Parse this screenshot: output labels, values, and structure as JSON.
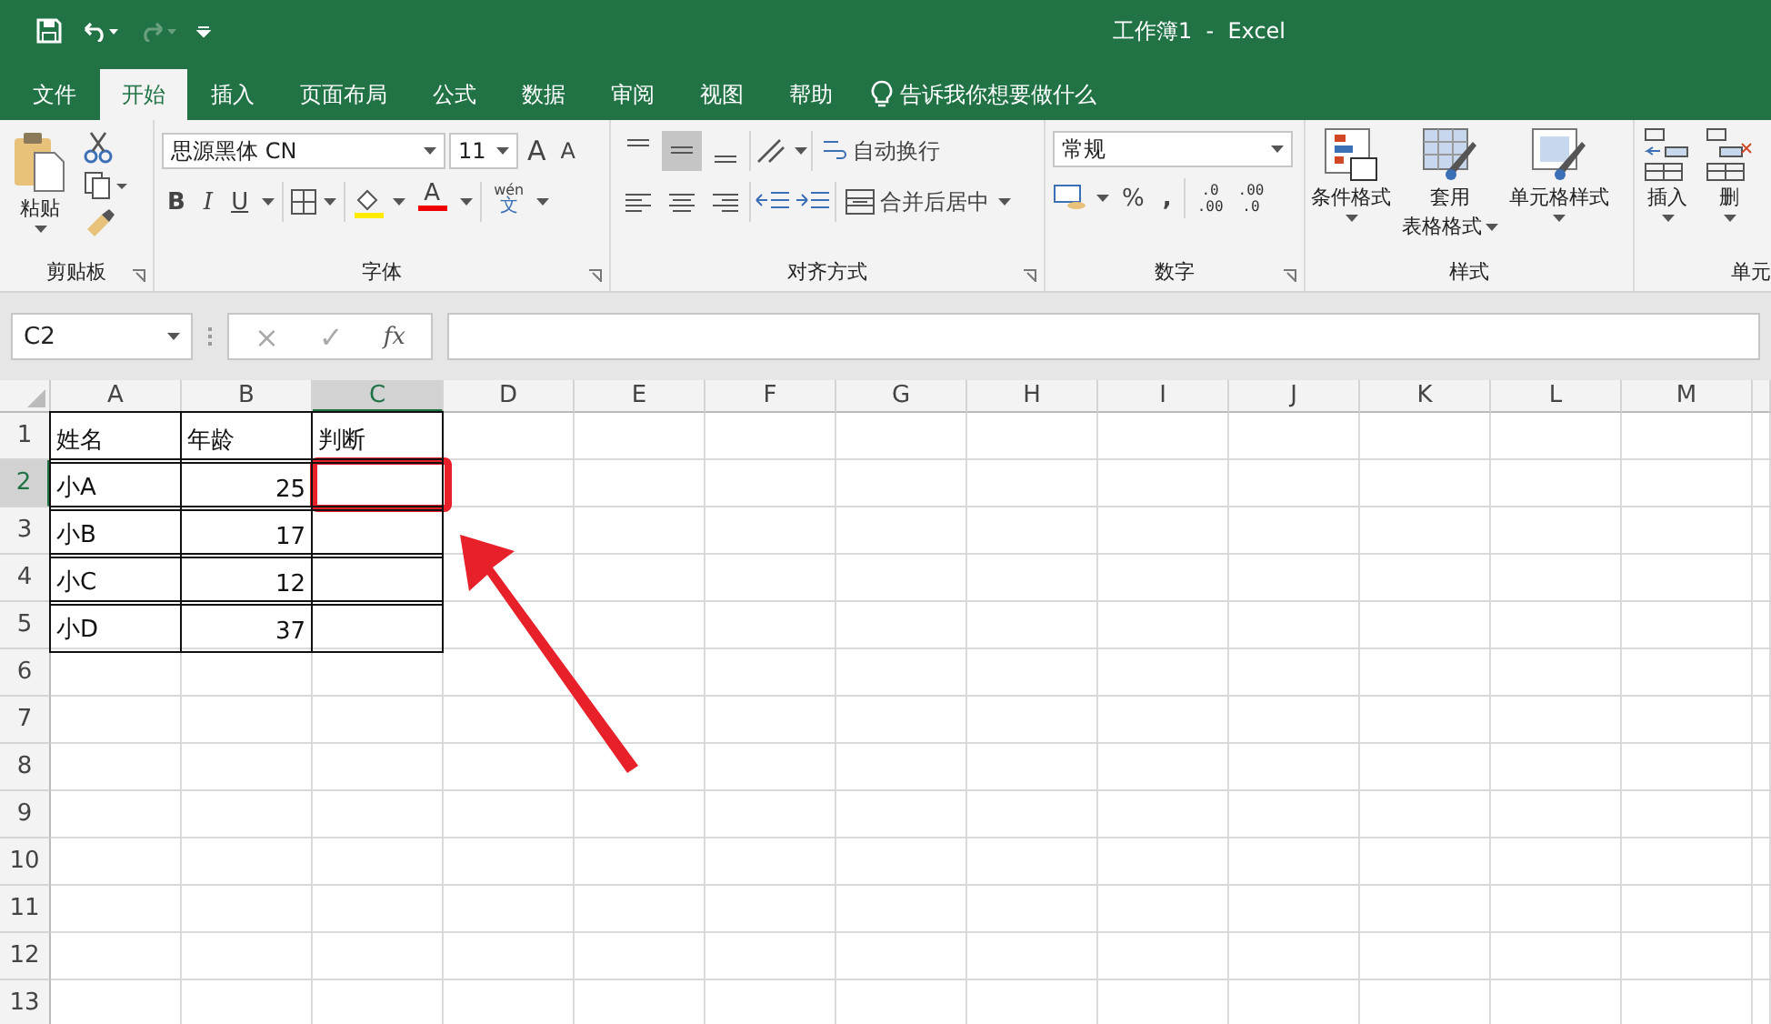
{
  "title_bar": {
    "title": "工作簿1  -  Excel"
  },
  "ribbon_tabs": [
    {
      "label": "文件",
      "selected": false
    },
    {
      "label": "开始",
      "selected": true
    },
    {
      "label": "插入",
      "selected": false
    },
    {
      "label": "页面布局",
      "selected": false
    },
    {
      "label": "公式",
      "selected": false
    },
    {
      "label": "数据",
      "selected": false
    },
    {
      "label": "审阅",
      "selected": false
    },
    {
      "label": "视图",
      "selected": false
    },
    {
      "label": "帮助",
      "selected": false
    }
  ],
  "tell_me": "告诉我你想要做什么",
  "clipboard": {
    "paste": "粘贴",
    "group": "剪贴板"
  },
  "font": {
    "name": "思源黑体 CN",
    "size": "11",
    "grow": "A",
    "shrink": "A",
    "bold": "B",
    "italic": "I",
    "underline": "U",
    "font_color": "A",
    "phonetic_top": "wén",
    "phonetic_bottom": "文",
    "group": "字体"
  },
  "alignment": {
    "wrap": "自动换行",
    "merge": "合并后居中",
    "group": "对齐方式"
  },
  "number": {
    "format": "常规",
    "percent": "%",
    "comma": ",",
    "increase_decimal": [
      ".0",
      ".00"
    ],
    "decrease_decimal": [
      ".00",
      ".0"
    ],
    "group": "数字"
  },
  "styles": {
    "conditional": "条件格式",
    "table_top": "套用",
    "table_bottom": "表格格式",
    "cell_styles": "单元格样式",
    "group": "样式"
  },
  "cells_group": {
    "insert": "插入",
    "delete": "删",
    "group": "单元"
  },
  "formula_bar": {
    "name_box": "C2",
    "cancel": "×",
    "enter": "✓",
    "fx": "fx"
  },
  "sheet": {
    "columns": [
      {
        "label": "A",
        "selected": false
      },
      {
        "label": "B",
        "selected": false
      },
      {
        "label": "C",
        "selected": true
      },
      {
        "label": "D",
        "selected": false
      },
      {
        "label": "E",
        "selected": false
      },
      {
        "label": "F",
        "selected": false
      },
      {
        "label": "G",
        "selected": false
      },
      {
        "label": "H",
        "selected": false
      },
      {
        "label": "I",
        "selected": false
      },
      {
        "label": "J",
        "selected": false
      },
      {
        "label": "K",
        "selected": false
      },
      {
        "label": "L",
        "selected": false
      },
      {
        "label": "M",
        "selected": false
      }
    ],
    "rows": [
      {
        "header": "1",
        "selected": false,
        "bordered": true,
        "cells": [
          {
            "kind": "text",
            "text": "姓名"
          },
          {
            "kind": "text",
            "text": "年龄"
          },
          {
            "kind": "text",
            "text": "判断"
          }
        ]
      },
      {
        "header": "2",
        "selected": true,
        "bordered": true,
        "cells": [
          {
            "kind": "text",
            "text": "小A"
          },
          {
            "kind": "number",
            "text": "25"
          }
        ]
      },
      {
        "header": "3",
        "selected": false,
        "bordered": true,
        "cells": [
          {
            "kind": "text",
            "text": "小B"
          },
          {
            "kind": "number",
            "text": "17"
          }
        ]
      },
      {
        "header": "4",
        "selected": false,
        "bordered": true,
        "cells": [
          {
            "kind": "text",
            "text": "小C"
          },
          {
            "kind": "number",
            "text": "12"
          }
        ]
      },
      {
        "header": "5",
        "selected": false,
        "bordered": true,
        "cells": [
          {
            "kind": "text",
            "text": "小D"
          },
          {
            "kind": "number",
            "text": "37"
          }
        ]
      },
      {
        "header": "6",
        "selected": false,
        "bordered": false
      },
      {
        "header": "7",
        "selected": false,
        "bordered": false
      },
      {
        "header": "8",
        "selected": false,
        "bordered": false
      },
      {
        "header": "9",
        "selected": false,
        "bordered": false
      },
      {
        "header": "10",
        "selected": false,
        "bordered": false
      },
      {
        "header": "11",
        "selected": false,
        "bordered": false
      },
      {
        "header": "12",
        "selected": false,
        "bordered": false
      },
      {
        "header": "13",
        "selected": false,
        "bordered": false
      }
    ]
  }
}
